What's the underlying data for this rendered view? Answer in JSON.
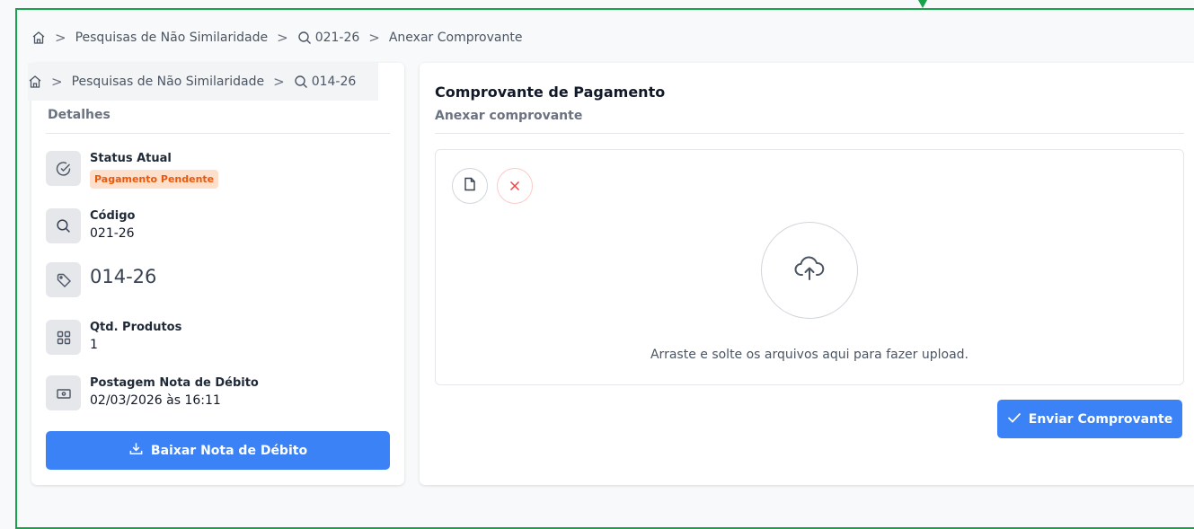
{
  "breadcrumb_main": {
    "items": [
      "Pesquisas de Não Similaridade",
      "021-26",
      "Anexar Comprovante"
    ]
  },
  "breadcrumb_inner": {
    "items": [
      "Pesquisas de Não Similaridade",
      "014-26"
    ]
  },
  "details": {
    "section_title": "Detalhes",
    "status_label": "Status Atual",
    "status_badge": "Pagamento Pendente",
    "code_label": "Código",
    "code_value": "021-26",
    "tag_value": "014-26",
    "qty_label": "Qtd. Produtos",
    "qty_value": "1",
    "posting_label": "Postagem Nota de Débito",
    "posting_value": "02/03/2026 às 16:11",
    "download_button": "Baixar Nota de Débito"
  },
  "payment": {
    "title": "Comprovante de Pagamento",
    "subtitle": "Anexar comprovante",
    "upload_hint": "Arraste e solte os arquivos aqui para fazer upload.",
    "send_button": "Enviar Comprovante"
  },
  "colors": {
    "frame_border": "#16a34a",
    "primary": "#3b82f6",
    "badge_bg": "#fde0cc",
    "badge_text": "#ea580c"
  },
  "icons": {
    "home": "home-icon",
    "search": "search-icon",
    "check_circle": "check-circle-icon",
    "tag": "tag-icon",
    "grid": "grid-icon",
    "money": "money-icon",
    "download": "download-icon",
    "file": "file-icon",
    "close": "close-icon",
    "upload": "cloud-upload-icon",
    "check": "check-icon"
  }
}
